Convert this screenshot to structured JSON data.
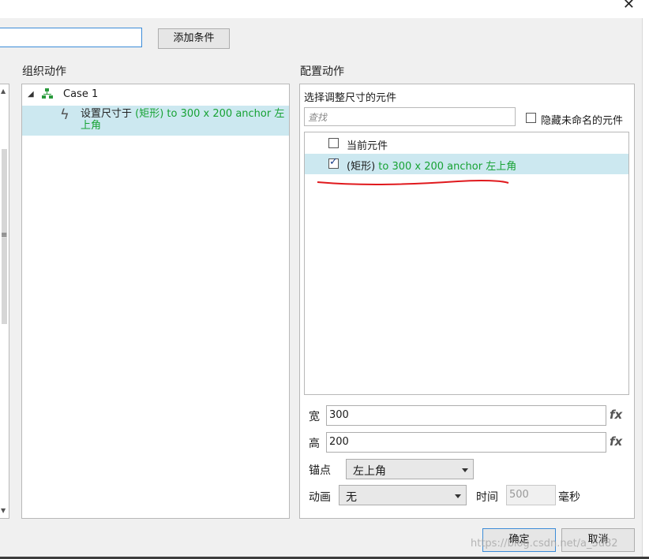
{
  "window": {
    "close_glyph": "✕"
  },
  "top": {
    "condition_input_value": "",
    "add_condition_label": "添加条件"
  },
  "organize": {
    "title": "组织动作",
    "case_label": "Case 1",
    "action_prefix": "设置尺寸于 ",
    "action_green": "(矩形) to 300 x 200 anchor 左上角"
  },
  "configure": {
    "title": "配置动作",
    "subtitle": "选择调整尺寸的元件",
    "search_placeholder": "查找",
    "hide_unnamed_label": "隐藏未命名的元件",
    "hide_unnamed_checked": false,
    "items": [
      {
        "label": "当前元件",
        "checked": false,
        "selected": false
      },
      {
        "label_black": "(矩形) ",
        "label_green": "to 300 x 200 anchor 左上角",
        "checked": true,
        "selected": true
      }
    ],
    "width_label": "宽",
    "width_value": "300",
    "height_label": "高",
    "height_value": "200",
    "fx_label": "fx",
    "anchor_label": "锚点",
    "anchor_value": "左上角",
    "animation_label": "动画",
    "animation_value": "无",
    "time_label": "时间",
    "time_value": "500",
    "ms_label": "毫秒"
  },
  "footer": {
    "ok_label": "确定",
    "cancel_label": "取消"
  },
  "watermark": "https://blog.csdn.net/a_3u82",
  "colors": {
    "accent": "#3c8cd8",
    "selection": "#cce8f0",
    "green_text": "#17a234",
    "annotation_red": "#e0191d"
  },
  "icons": [
    "close-icon",
    "case-tree-icon",
    "lightning-icon",
    "fx-icon",
    "dropdown-caret-icon",
    "checkbox-icon"
  ]
}
